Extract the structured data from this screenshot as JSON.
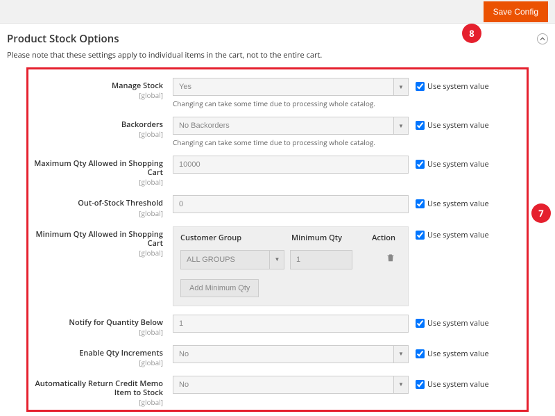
{
  "topbar": {
    "save_label": "Save Config"
  },
  "section": {
    "title": "Product Stock Options",
    "note": "Please note that these settings apply to individual items in the cart, not to the entire cart."
  },
  "use_system_label": "Use system value",
  "scope_global": "[global]",
  "badges": {
    "seven": "7",
    "eight": "8"
  },
  "fields": {
    "manage_stock": {
      "label": "Manage Stock",
      "value": "Yes",
      "hint": "Changing can take some time due to processing whole catalog."
    },
    "backorders": {
      "label": "Backorders",
      "value": "No Backorders",
      "hint": "Changing can take some time due to processing whole catalog."
    },
    "max_qty": {
      "label": "Maximum Qty Allowed in Shopping Cart",
      "value": "10000"
    },
    "oos_threshold": {
      "label": "Out-of-Stock Threshold",
      "value": "0"
    },
    "min_qty": {
      "label": "Minimum Qty Allowed in Shopping Cart",
      "table": {
        "head_group": "Customer Group",
        "head_min": "Minimum Qty",
        "head_action": "Action",
        "row": {
          "group": "ALL GROUPS",
          "qty": "1"
        },
        "add_label": "Add Minimum Qty"
      }
    },
    "notify_qty": {
      "label": "Notify for Quantity Below",
      "value": "1"
    },
    "enable_qty_inc": {
      "label": "Enable Qty Increments",
      "value": "No"
    },
    "auto_return": {
      "label": "Automatically Return Credit Memo Item to Stock",
      "value": "No"
    }
  }
}
